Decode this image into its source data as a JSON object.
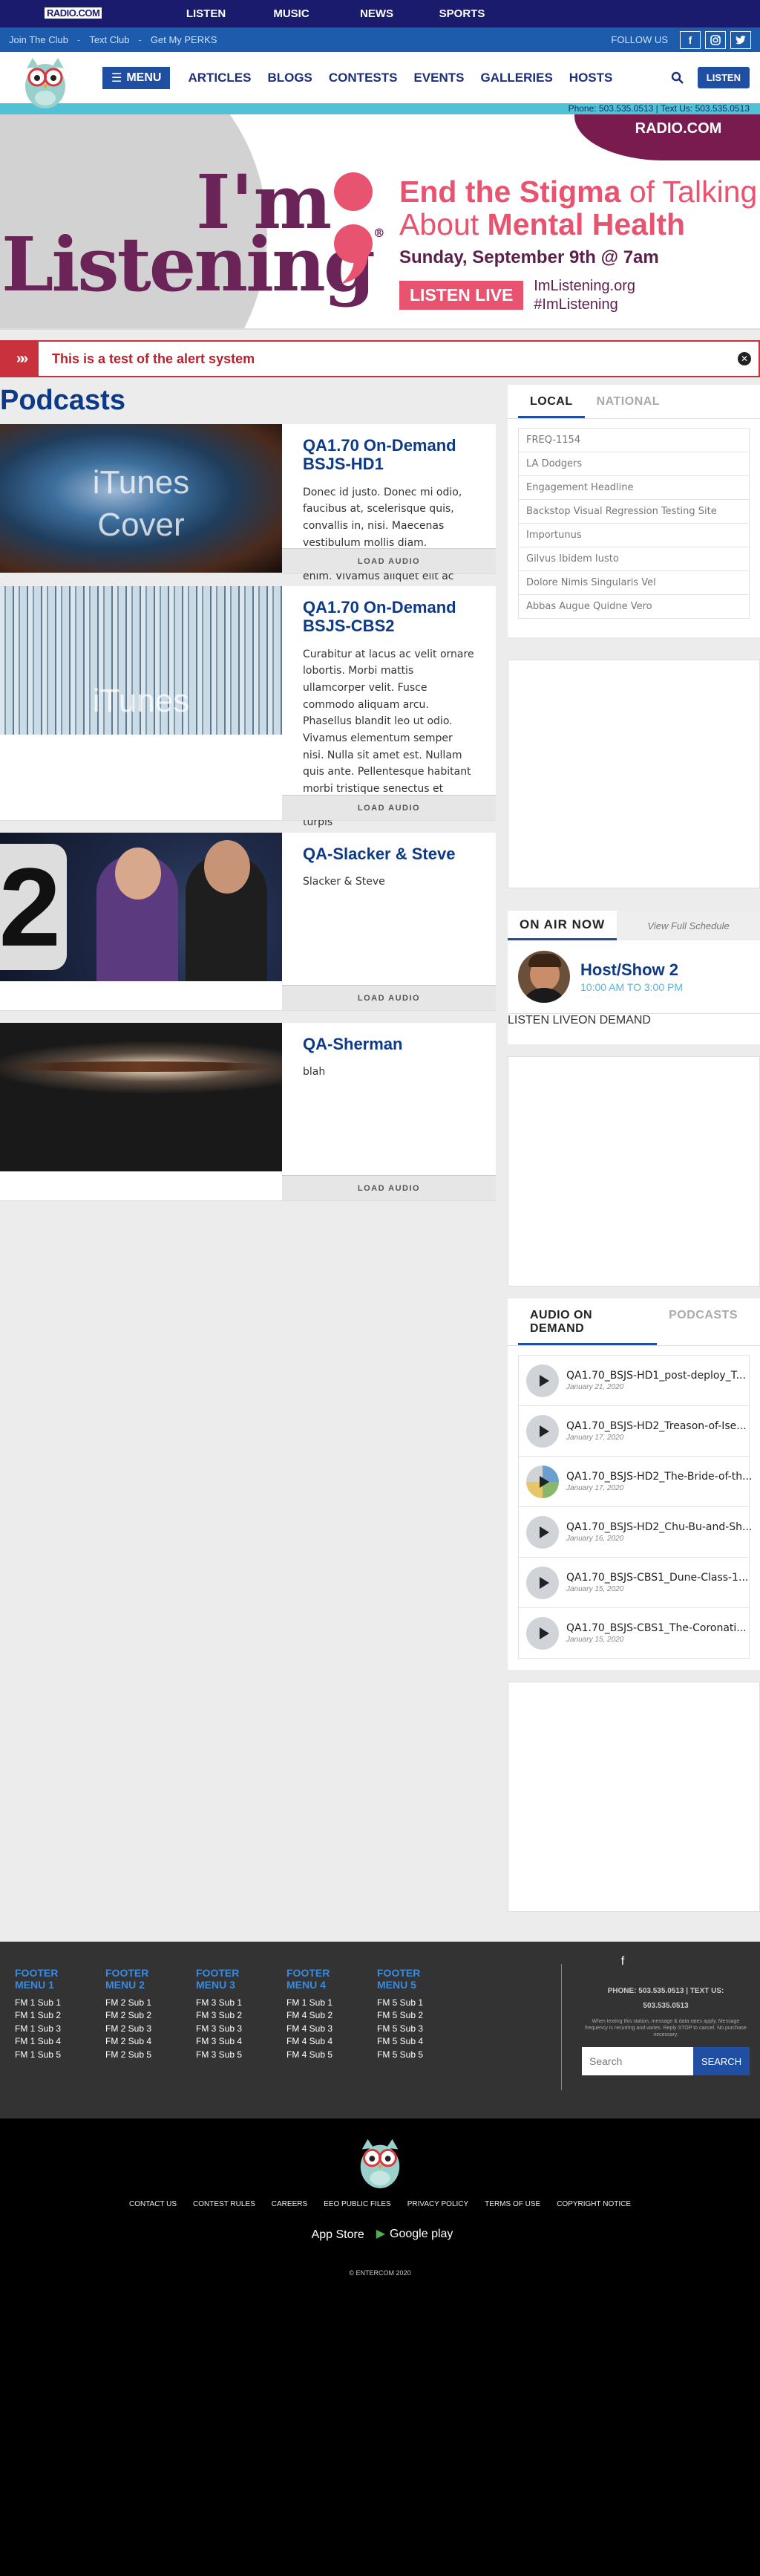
{
  "topbar": {
    "logo": "RADIO.COM",
    "nav": [
      "LISTEN",
      "MUSIC",
      "NEWS",
      "SPORTS"
    ]
  },
  "clubbar": {
    "links": [
      "Join The Club",
      "Text Club",
      "Get My PERKS"
    ],
    "follow_label": "FOLLOW US"
  },
  "mainnav": {
    "menu_label": "MENU",
    "links": [
      "ARTICLES",
      "BLOGS",
      "CONTESTS",
      "EVENTS",
      "GALLERIES",
      "HOSTS"
    ],
    "listen_label": "LISTEN"
  },
  "phonebar": "Phone: 503.535.0513 | Text Us: 503.535.0513",
  "hero": {
    "brand": "RADIO.COM",
    "im": "I'm",
    "listening": "Listening",
    "reg": "®",
    "line1a": "End the Stigma",
    "line1b": " of Talking",
    "line2a": "About ",
    "line2b": "Mental Health",
    "date": "Sunday, September 9th @ 7am",
    "listen_live": "LISTEN LIVE",
    "tag1": "ImListening.org",
    "tag2": "#ImListening"
  },
  "alert": {
    "message": "This is a test of the alert system",
    "chevrons": "»»"
  },
  "podcasts": {
    "heading": "Podcasts",
    "load_label": "LOAD AUDIO",
    "items": [
      {
        "title": "QA1.70 On-Demand BSJS-HD1",
        "desc": "Donec id justo. Donec mi odio, faucibus at, scelerisque quis, convallis in, nisi. Maecenas vestibulum mollis diam. Praesent egestas neque eu enim. Vivamus aliquet elit ac nisl.",
        "thumb_text": "iTunes\nCover"
      },
      {
        "title": "QA1.70 On-Demand BSJS-CBS2",
        "desc": "Curabitur at lacus ac velit ornare lobortis. Morbi mattis ullamcorper velit. Fusce commodo aliquam arcu. Phasellus blandit leo ut odio. Vivamus elementum semper nisi. Nulla sit amet est. Nullam quis ante. Pellentesque habitant morbi tristique senectus et netus et malesuada fames ac turpis",
        "thumb_text": "iTunes"
      },
      {
        "title": "QA-Slacker & Steve",
        "desc": "Slacker & Steve",
        "thumb_text": "2"
      },
      {
        "title": "QA-Sherman",
        "desc": "blah",
        "thumb_text": ""
      }
    ]
  },
  "sidebar": {
    "tabs": [
      "LOCAL",
      "NATIONAL"
    ],
    "local_items": [
      "FREQ-1154",
      "LA Dodgers",
      "Engagement Headline",
      "Backstop Visual Regression Testing Site",
      "Importunus",
      "Gilvus Ibidem Iusto",
      "Dolore Nimis Singularis Vel",
      "Abbas Augue Quidne Vero"
    ],
    "onair": {
      "label": "ON AIR NOW",
      "schedule": "View Full Schedule",
      "show": "Host/Show 2",
      "time": "10:00 AM TO 3:00 PM",
      "listen_live": "LISTEN LIVE",
      "on_demand": "ON DEMAND"
    },
    "aod_tabs": [
      "AUDIO ON DEMAND",
      "PODCASTS"
    ],
    "aod_items": [
      {
        "title": "QA1.70_BSJS-HD1_post-deploy_T...",
        "date": "January 21, 2020"
      },
      {
        "title": "QA1.70_BSJS-HD2_Treason-of-Ise...",
        "date": "January 17, 2020"
      },
      {
        "title": "QA1.70_BSJS-HD2_The-Bride-of-th...",
        "date": "January 17, 2020"
      },
      {
        "title": "QA1.70_BSJS-HD2_Chu-Bu-and-Sh...",
        "date": "January 16, 2020"
      },
      {
        "title": "QA1.70_BSJS-CBS1_Dune-Class-1...",
        "date": "January 15, 2020"
      },
      {
        "title": "QA1.70_BSJS-CBS1_The-Coronati...",
        "date": "January 15, 2020"
      }
    ]
  },
  "footer": {
    "menus": [
      {
        "title": "FOOTER MENU 1",
        "items": [
          "FM 1 Sub 1",
          "FM 1 Sub 2",
          "FM 1 Sub 3",
          "FM 1 Sub 4",
          "FM 1 Sub 5"
        ]
      },
      {
        "title": "FOOTER MENU 2",
        "items": [
          "FM 2 Sub 1",
          "FM 2 Sub 2",
          "FM 2 Sub 3",
          "FM 2 Sub 4",
          "FM 2 Sub 5"
        ]
      },
      {
        "title": "FOOTER MENU 3",
        "items": [
          "FM 3 Sub 1",
          "FM 3 Sub 2",
          "FM 3 Sub 3",
          "FM 3 Sub 4",
          "FM 3 Sub 5"
        ]
      },
      {
        "title": "FOOTER MENU 4",
        "items": [
          "FM 1 Sub 1",
          "FM 4 Sub 2",
          "FM 4 Sub 3",
          "FM 4 Sub 4",
          "FM 4 Sub 5"
        ]
      },
      {
        "title": "FOOTER MENU 5",
        "items": [
          "FM 5 Sub 1",
          "FM 5 Sub 2",
          "FM 5 Sub 3",
          "FM 5 Sub 4",
          "FM 5 Sub 5"
        ]
      }
    ],
    "phone1": "PHONE: 503.535.0513 | TEXT US:",
    "phone2": "503.535.0513",
    "fine": "When texting this station, message & data rates apply. Message frequency is recurring and varies. Reply STOP to cancel. No purchase necessary.",
    "search_placeholder": "Search",
    "search_button": "SEARCH",
    "links": [
      "CONTACT US",
      "CONTEST RULES",
      "CAREERS",
      "EEO PUBLIC FILES",
      "PRIVACY POLICY",
      "TERMS OF USE",
      "COPYRIGHT NOTICE"
    ],
    "app_store": "App Store",
    "google_play": "Google play",
    "copyright": "© ENTERCOM 2020"
  },
  "colors": {
    "brand": "#1b1b6e",
    "accent": "#1f4ea3",
    "alert": "#c9313c",
    "hero_plum": "#6b2458",
    "hero_pink": "#e8536f"
  }
}
